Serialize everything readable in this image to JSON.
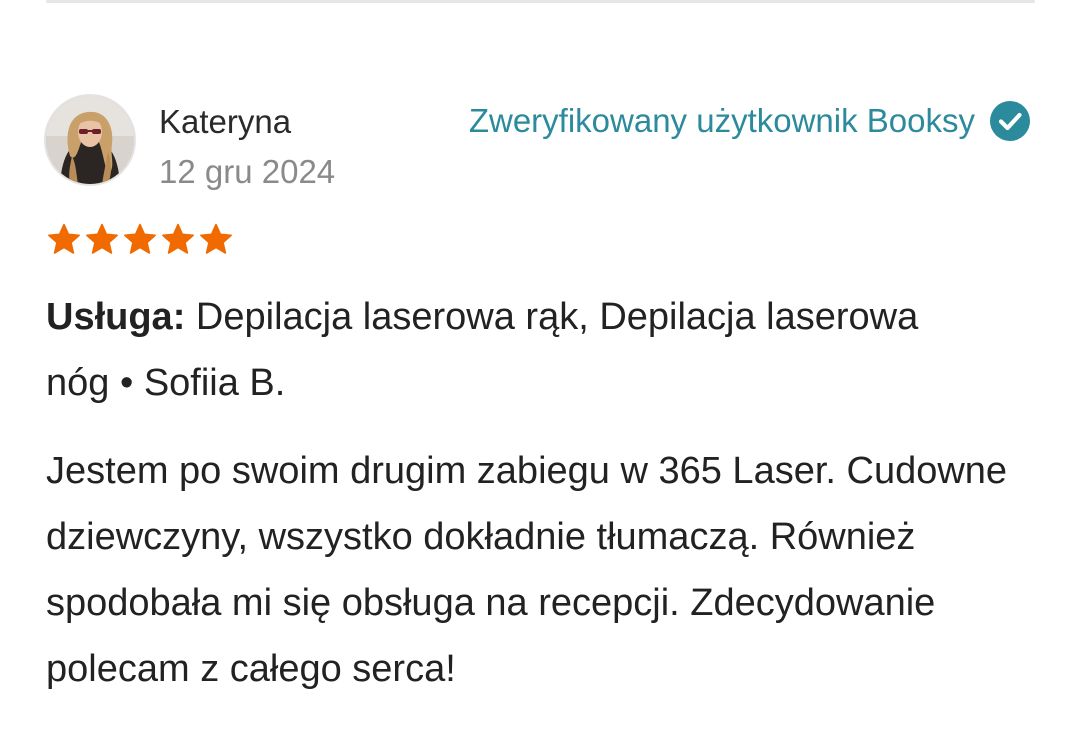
{
  "review": {
    "author": "Kateryna",
    "date": "12 gru 2024",
    "verified_label": "Zweryfikowany użytkownik Booksy",
    "rating": 5,
    "service_label": "Usługa:",
    "service_value": "Depilacja laserowa rąk, Depilacja laserowa nóg • Sofiia B.",
    "text": "Jestem po swoim drugim zabiegu w 365 Laser. Cudowne dziewczyny, wszystko dokładnie tłumaczą. Również spodobała mi się obsługa na recepcji. Zdecydowanie polecam z całego serca!"
  },
  "colors": {
    "verified": "#2b8a9b",
    "star": "#f06a00",
    "text": "#222222",
    "muted": "#8a8a8a"
  },
  "icons": {
    "avatar": "user-photo",
    "verified": "check-circle-icon",
    "rating": "star-icon"
  }
}
